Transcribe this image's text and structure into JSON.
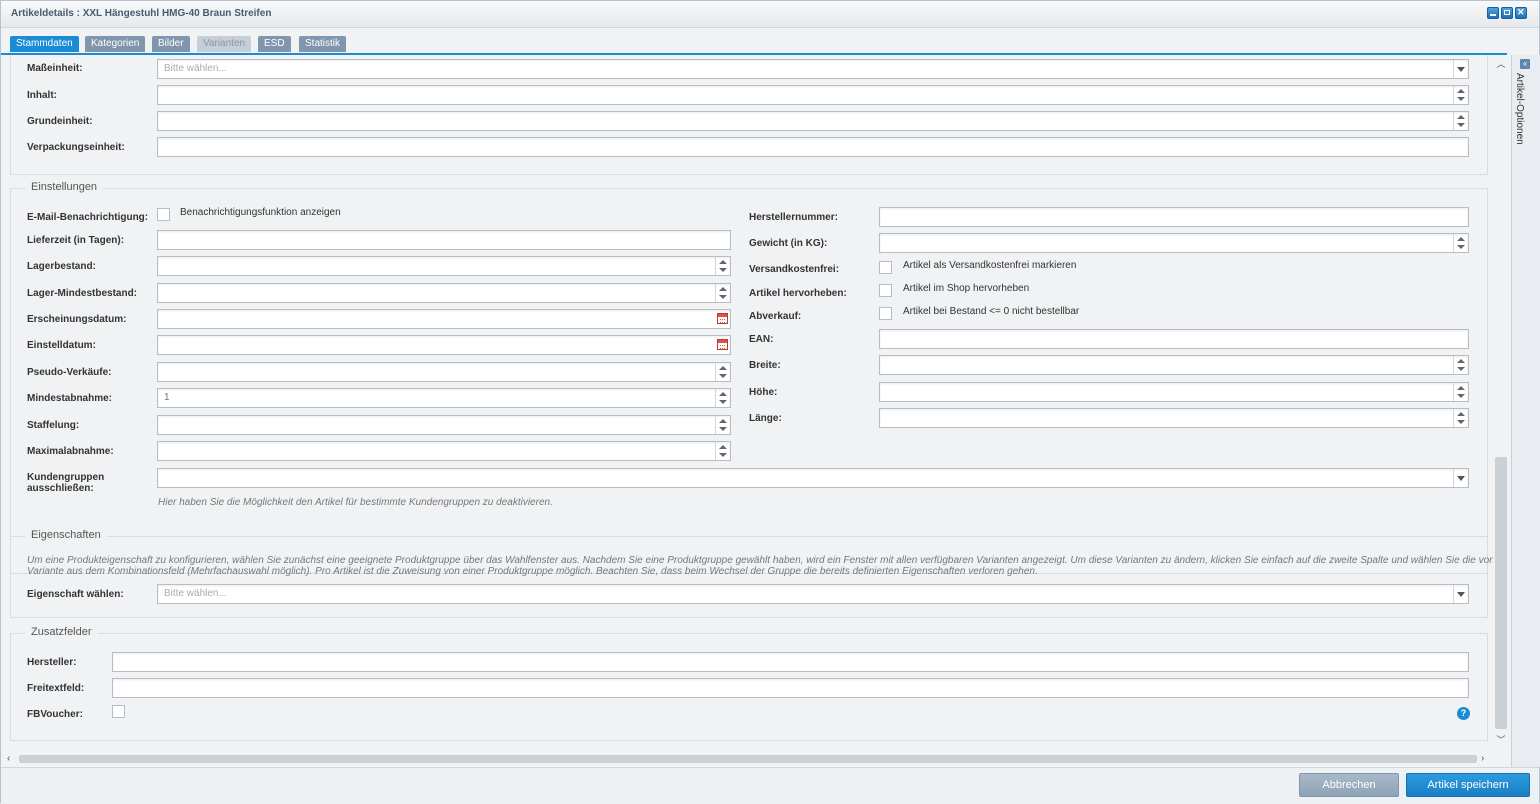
{
  "window": {
    "title": "Artikeldetails : XXL Hängestuhl HMG-40 Braun Streifen"
  },
  "tabs": [
    "Stammdaten",
    "Kategorien",
    "Bilder",
    "Varianten",
    "ESD",
    "Statistik"
  ],
  "side_panel": {
    "label": "Artikel-Optionen"
  },
  "top_section": {
    "masseinheit_label": "Maßeinheit:",
    "masseinheit_placeholder": "Bitte wählen...",
    "inhalt_label": "Inhalt:",
    "grundeinheit_label": "Grundeinheit:",
    "verpackungseinheit_label": "Verpackungseinheit:"
  },
  "einstellungen": {
    "legend": "Einstellungen",
    "email_label": "E-Mail-Benachrichtigung:",
    "email_checkbox_label": "Benachrichtigungsfunktion anzeigen",
    "lieferzeit_label": "Lieferzeit (in Tagen):",
    "lagerbestand_label": "Lagerbestand:",
    "lager_mindest_label": "Lager-Mindestbestand:",
    "erscheinungsdatum_label": "Erscheinungsdatum:",
    "einstelldatum_label": "Einstelldatum:",
    "pseudo_label": "Pseudo-Verkäufe:",
    "mindestabnahme_label": "Mindestabnahme:",
    "mindestabnahme_value": "1",
    "staffelung_label": "Staffelung:",
    "maximalabnahme_label": "Maximalabnahme:",
    "kundengruppen_label_1": "Kundengruppen",
    "kundengruppen_label_2": "ausschließen:",
    "kundengruppen_hint": "Hier haben Sie die Möglichkeit den Artikel für bestimmte Kundengruppen zu deaktivieren.",
    "herstellernummer_label": "Herstellernummer:",
    "gewicht_label": "Gewicht (in KG):",
    "versandkostenfrei_label": "Versandkostenfrei:",
    "versandkostenfrei_checkbox_label": "Artikel als Versandkostenfrei markieren",
    "hervorheben_label": "Artikel hervorheben:",
    "hervorheben_checkbox_label": "Artikel im Shop hervorheben",
    "abverkauf_label": "Abverkauf:",
    "abverkauf_checkbox_label": "Artikel bei Bestand <= 0 nicht bestellbar",
    "ean_label": "EAN:",
    "breite_label": "Breite:",
    "hoehe_label": "Höhe:",
    "laenge_label": "Länge:"
  },
  "eigenschaften": {
    "legend": "Eigenschaften",
    "description_line1": "Um eine Produkteigenschaft zu konfigurieren, wählen Sie zunächst eine geeignete Produktgruppe über das Wahlfenster aus. Nachdem Sie eine Produktgruppe gewählt haben, wird ein Fenster mit allen verfügbaren Varianten angezeigt. Um diese Varianten zu ändern, klicken Sie einfach auf die zweite Spalte und wählen Sie die von Ihnen gewünschte",
    "description_line2": "Variante aus dem Kombinationsfeld (Mehrfachauswahl möglich). Pro Artikel ist die Zuweisung von einer Produktgruppe möglich. Beachten Sie, dass beim Wechsel der Gruppe die bereits definierten Eigenschaften verloren gehen.",
    "eigenschaft_label": "Eigenschaft wählen:",
    "eigenschaft_placeholder": "Bitte wählen..."
  },
  "zusatzfelder": {
    "legend": "Zusatzfelder",
    "hersteller_label": "Hersteller:",
    "freitext_label": "Freitextfeld:",
    "fbvoucher_label": "FBVoucher:",
    "help_glyph": "?"
  },
  "footer": {
    "cancel_label": "Abbrechen",
    "save_label": "Artikel speichern"
  },
  "colors": {
    "accent": "#1a8bd4",
    "tab_inactive": "#7f96ac",
    "tab_disabled": "#c6cfd7",
    "cancel": "#9aaec0"
  }
}
